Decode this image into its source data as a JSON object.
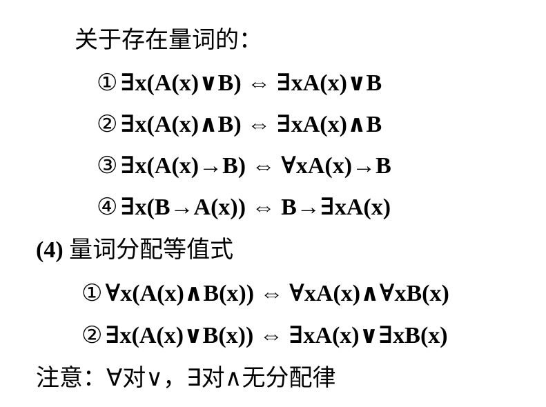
{
  "heading": "关于存在量词的：",
  "existential": [
    {
      "num": "①",
      "formula": "∃x(A(x)∨B) ⇔ ∃xA(x)∨B"
    },
    {
      "num": "②",
      "formula": "∃x(A(x)∧B) ⇔ ∃xA(x)∧B"
    },
    {
      "num": "③",
      "formula": "∃x(A(x)→B) ⇔ ∀xA(x)→B"
    },
    {
      "num": "④",
      "formula": "∃x(B→A(x)) ⇔ B→∃xA(x)"
    }
  ],
  "section4": {
    "label": "(4)",
    "title": "量词分配等值式"
  },
  "distribution": [
    {
      "num": "①",
      "formula": "∀x(A(x)∧B(x)) ⇔ ∀xA(x)∧∀xB(x)"
    },
    {
      "num": "②",
      "formula": "∃x(A(x)∨B(x)) ⇔ ∃xA(x)∨∃xB(x)"
    }
  ],
  "note": "注意：∀对∨，∃对∧无分配律"
}
